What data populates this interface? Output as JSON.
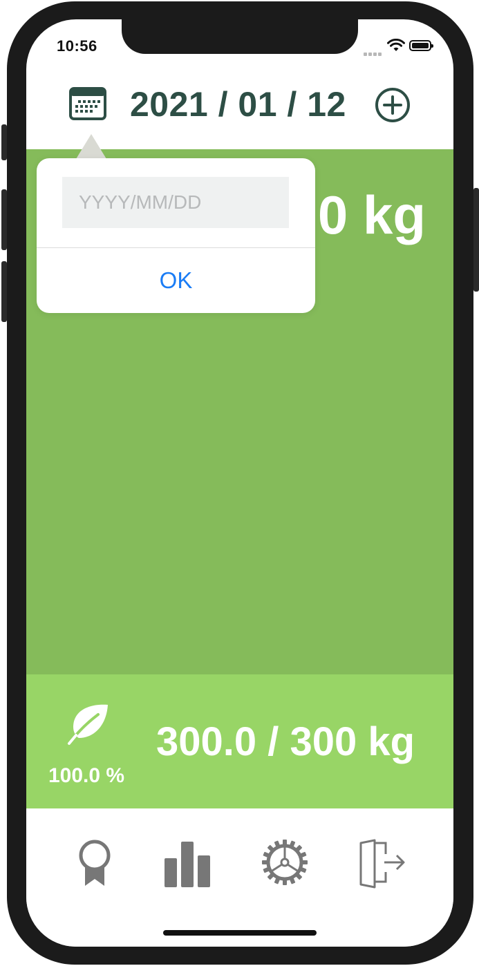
{
  "status_bar": {
    "time": "10:56"
  },
  "header": {
    "date": "2021 / 01 / 12",
    "calendar_icon": "calendar-icon",
    "add_icon": "plus-circle-icon"
  },
  "main": {
    "value": "0 kg"
  },
  "date_popover": {
    "input_value": "",
    "input_placeholder": "YYYY/MM/DD",
    "ok_label": "OK"
  },
  "summary": {
    "icon": "leaf-icon",
    "percent": "100.0 %",
    "total": "300.0 / 300 kg"
  },
  "tabbar": {
    "items": [
      {
        "icon": "award-ribbon-icon"
      },
      {
        "icon": "bar-chart-icon"
      },
      {
        "icon": "gear-icon"
      },
      {
        "icon": "logout-door-icon"
      }
    ]
  },
  "colors": {
    "header_text": "#2d4e45",
    "main_green": "#85bb5a",
    "summary_green": "#98d566",
    "link_blue": "#1a7cf5",
    "tab_icon_gray": "#777777"
  }
}
